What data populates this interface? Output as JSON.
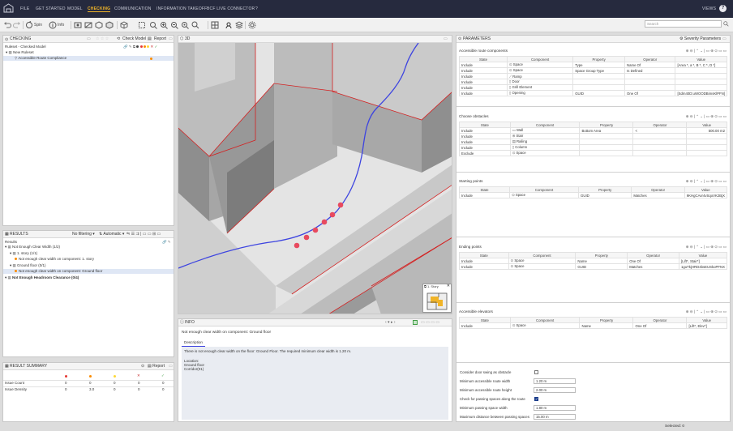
{
  "menubar": {
    "items": [
      "FILE",
      "GET STARTED",
      "MODEL",
      "CHECKING",
      "COMMUNICATION",
      "INFORMATION TAKEOFF",
      "BCF LIVE CONNECTOR",
      "?"
    ],
    "active_index": 3,
    "right": "VIEWS",
    "help": "?"
  },
  "toolbar": {
    "spin_label": "Spin",
    "info_label": "Info",
    "search_placeholder": "Search"
  },
  "checking": {
    "title": "CHECKING",
    "check_model_label": "Check Model",
    "report_label": "Report",
    "ruleset_label": "Ruleset - Checked Model",
    "tree": [
      {
        "label": "New Ruleset",
        "level": 0
      },
      {
        "label": "Accessible Route Compliance",
        "level": 1
      }
    ]
  },
  "results": {
    "title": "RESULTS",
    "filter_label": "No filtering",
    "auto_label": "Automatic",
    "header": "Results",
    "tree": [
      {
        "label": "Not Enough Clear Width (1/2)",
        "level": 0,
        "bold": false,
        "selected": false
      },
      {
        "label": "1. story (1/1)",
        "level": 1,
        "bold": false,
        "selected": false
      },
      {
        "label": "Not enough clear width on component: 1. story",
        "level": 2,
        "bold": false,
        "selected": false
      },
      {
        "label": "Ground floor (0/1)",
        "level": 1,
        "bold": false,
        "selected": false
      },
      {
        "label": "Not enough clear width on component: Ground floor",
        "level": 2,
        "bold": false,
        "selected": true
      },
      {
        "label": "Not Enough Headroom Clearance (0/4)",
        "level": 0,
        "bold": true,
        "selected": false
      }
    ]
  },
  "summary": {
    "title": "RESULT SUMMARY",
    "report_label": "Report",
    "rows": [
      {
        "label": "Issue Count",
        "values": [
          "0",
          "0",
          "0",
          "0",
          "0"
        ]
      },
      {
        "label": "Issue Density",
        "values": [
          "0",
          "3.0",
          "0",
          "0",
          "0"
        ]
      }
    ]
  },
  "viewport": {
    "title": "3D",
    "story_label": "1. Story"
  },
  "info": {
    "title": "INFO",
    "heading": "Not enough clear width on component: Ground floor",
    "tab": "Description",
    "text": "There is not enough clear width on the floor: Ground Floor. The required minimum clear width is 1.20 m.",
    "location_label": "Location:",
    "location_lines": [
      "Ground floor",
      "Corridor(01)"
    ]
  },
  "parameters": {
    "title": "PARAMETERS",
    "severity_label": "Severity Parameters",
    "columns": [
      "State",
      "Component",
      "Property",
      "Operator",
      "Value"
    ],
    "sections": [
      {
        "title": "Accessible route components",
        "rows": [
          [
            "Include",
            "Space",
            "Type",
            "Name Of",
            "[Area *, a *, B *, C *, D *]"
          ],
          [
            "Include",
            "Space",
            "Space Group Type",
            "Is Defined",
            ""
          ],
          [
            "Include",
            "Ramp",
            "",
            "",
            ""
          ],
          [
            "Include",
            "Door",
            "",
            "",
            ""
          ],
          [
            "Include",
            "Grill Element",
            "",
            "",
            ""
          ],
          [
            "Include",
            "Opening",
            "GUID",
            "One Of",
            "[Sdm40D:uWOODBimsKlPFN]"
          ]
        ]
      },
      {
        "title": "Choose obstacles",
        "rows": [
          [
            "Include",
            "Wall",
            "Bottom Area",
            "<",
            "500.00 m2"
          ],
          [
            "Include",
            "Stair",
            "",
            "",
            ""
          ],
          [
            "Include",
            "Railing",
            "",
            "",
            ""
          ],
          [
            "Include",
            "Column",
            "",
            "",
            ""
          ],
          [
            "Exclude",
            "Space",
            "",
            "",
            ""
          ]
        ]
      },
      {
        "title": "Starting points",
        "rows": [
          [
            "Include",
            "Space",
            "GUID",
            "Matches",
            "9KHgCAvr4vSqoVK2BjX"
          ]
        ]
      },
      {
        "title": "Ending points",
        "rows": [
          [
            "Include",
            "Space",
            "Name",
            "One Of",
            "[Lift*, Stair*]"
          ],
          [
            "Include",
            "Space",
            "GUID",
            "Matches",
            "1guTkjHRD4bsEUSkoPFNX"
          ]
        ]
      },
      {
        "title": "Accessible elevators",
        "rows": [
          [
            "Include",
            "Space",
            "Name",
            "One Of",
            "[Lift*, Elev*]"
          ]
        ]
      }
    ],
    "options": [
      {
        "label": "Consider door swing as obstacle",
        "kind": "check",
        "value": false
      },
      {
        "label": "Minimum accessible route width",
        "kind": "input",
        "value": "1.20 m"
      },
      {
        "label": "Minimum accessible route height",
        "kind": "input",
        "value": "2.00 m"
      },
      {
        "label": "Check for passing spaces along the route",
        "kind": "check",
        "value": true
      },
      {
        "label": "Minimum passing space width",
        "kind": "input",
        "value": "1.80 m"
      },
      {
        "label": "Maximum distance between passing spaces",
        "kind": "input",
        "value": "15.00 m"
      }
    ]
  },
  "status": {
    "selected": "Selected: 0"
  },
  "colors": {
    "menubar_bg": "#262a3e",
    "active": "#f0b429",
    "route_line": "#3d44e0",
    "issue_dot": "#e84a5f",
    "edge_red": "#d42020"
  }
}
